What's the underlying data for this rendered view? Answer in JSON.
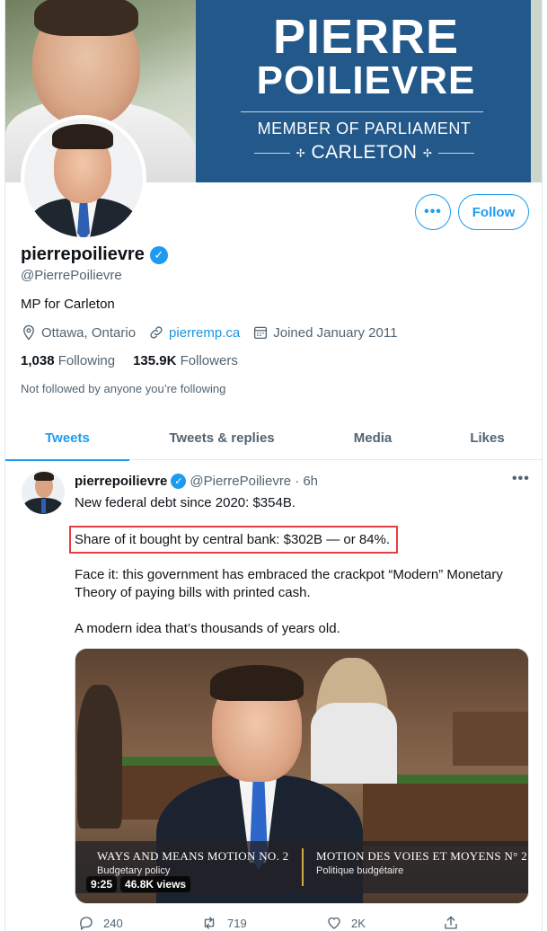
{
  "banner": {
    "name_line1": "PIERRE",
    "name_line2": "POILIEVRE",
    "role": "MEMBER OF PARLIAMENT",
    "riding": "CARLETON",
    "maple_glyph": "✢",
    "accent": "#22598a"
  },
  "profile": {
    "display_name": "pierrepoilievre",
    "handle": "@PierrePoilievre",
    "bio": "MP for Carleton",
    "location": "Ottawa, Ontario",
    "website": "pierremp.ca",
    "joined": "Joined January 2011",
    "following_count": "1,038",
    "following_label": "Following",
    "followers_count": "135.9K",
    "followers_label": "Followers",
    "not_followed": "Not followed by anyone you’re following",
    "more_label": "•••",
    "follow_label": "Follow",
    "verified_glyph": "✓"
  },
  "tabs": [
    {
      "label": "Tweets",
      "active": true
    },
    {
      "label": "Tweets & replies",
      "active": false
    },
    {
      "label": "Media",
      "active": false
    },
    {
      "label": "Likes",
      "active": false
    }
  ],
  "tweet": {
    "author": "pierrepoilievre",
    "handle": "@PierrePoilievre",
    "time": "· 6h",
    "more_label": "•••",
    "line1": "New federal debt since 2020: $354B.",
    "line2": "Share of it bought by central bank: $302B — or 84%.",
    "line3a": "Face it: this government has embraced the crackpot “Modern” Monetary",
    "line3b": "Theory of paying bills with printed cash.",
    "line4": "A modern idea that’s thousands of years old.",
    "media": {
      "left_title": "WAYS AND MEANS MOTION NO. 2",
      "left_sub": "Budgetary policy",
      "right_title": "MOTION DES VOIES ET MOYENS N° 2",
      "right_sub": "Politique budgétaire",
      "duration": "9:25",
      "views": "46.8K views"
    },
    "actions": {
      "replies": "240",
      "retweets": "719",
      "likes": "2K"
    }
  },
  "colors": {
    "twitter_blue": "#1d9bf0",
    "highlight_red": "#e2403f",
    "secondary_text": "#536471"
  }
}
